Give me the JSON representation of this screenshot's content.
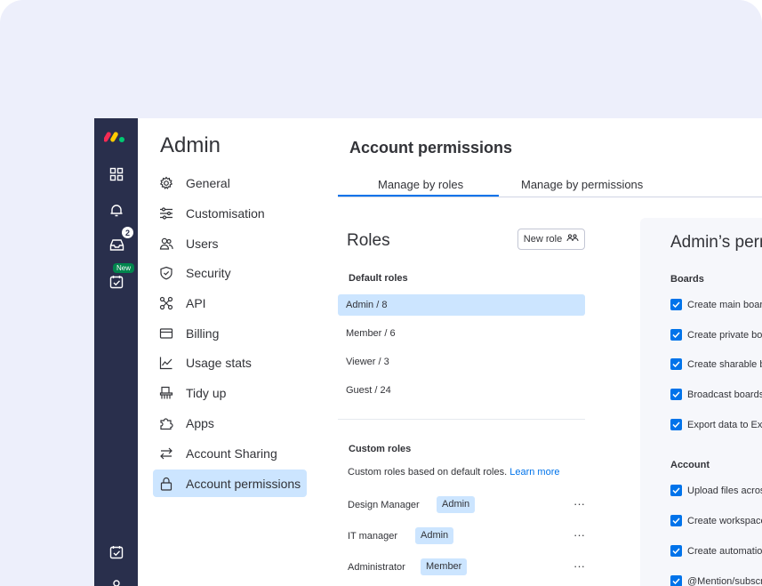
{
  "colors": {
    "background": "#edeffb",
    "rail": "#292f4c",
    "accent": "#0073ea",
    "selected": "#cce5ff",
    "new_badge": "#00854d"
  },
  "rail": {
    "notifications_count": "2",
    "new_badge": "New",
    "icons": [
      "monday-logo-icon",
      "grid-apps-icon",
      "bell-icon",
      "inbox-icon",
      "my-work-icon",
      "my-work-icon-bottom",
      "profile-icon"
    ]
  },
  "sidebar": {
    "title": "Admin",
    "items": [
      {
        "label": "General",
        "icon": "gear-icon"
      },
      {
        "label": "Customisation",
        "icon": "sliders-icon"
      },
      {
        "label": "Users",
        "icon": "users-icon"
      },
      {
        "label": "Security",
        "icon": "shield-icon"
      },
      {
        "label": "API",
        "icon": "api-icon"
      },
      {
        "label": "Billing",
        "icon": "credit-card-icon"
      },
      {
        "label": "Usage stats",
        "icon": "chart-icon"
      },
      {
        "label": "Tidy up",
        "icon": "broom-icon"
      },
      {
        "label": "Apps",
        "icon": "puzzle-icon"
      },
      {
        "label": "Account Sharing",
        "icon": "arrows-swap-icon"
      },
      {
        "label": "Account permissions",
        "icon": "lock-icon",
        "active": true
      }
    ]
  },
  "main": {
    "title": "Account permissions",
    "tabs": [
      {
        "label": "Manage by roles",
        "active": true
      },
      {
        "label": "Manage by permissions",
        "active": false
      }
    ],
    "roles": {
      "title": "Roles",
      "new_role_label": "New role",
      "default_heading": "Default roles",
      "default_roles": [
        "Admin / 8",
        "Member / 6",
        "Viewer / 3",
        "Guest / 24"
      ],
      "custom_heading": "Custom roles",
      "custom_desc": "Custom roles based on default roles.",
      "learn_more": "Learn more",
      "custom_roles": [
        {
          "name": "Design Manager",
          "base": "Admin",
          "more": "···"
        },
        {
          "name": "IT manager",
          "base": "Admin",
          "more": "···"
        },
        {
          "name": "Administrator",
          "base": "Member",
          "more": "···"
        }
      ]
    },
    "permissions": {
      "title": "Admin’s perm",
      "boards_heading": "Boards",
      "boards": [
        "Create main boards",
        "Create private boards",
        "Create sharable boards",
        "Broadcast boards",
        "Export data to Excel"
      ],
      "account_heading": "Account",
      "account": [
        "Upload files across",
        "Create workspaces",
        "Create automations",
        "@Mention/subscribe"
      ]
    }
  }
}
